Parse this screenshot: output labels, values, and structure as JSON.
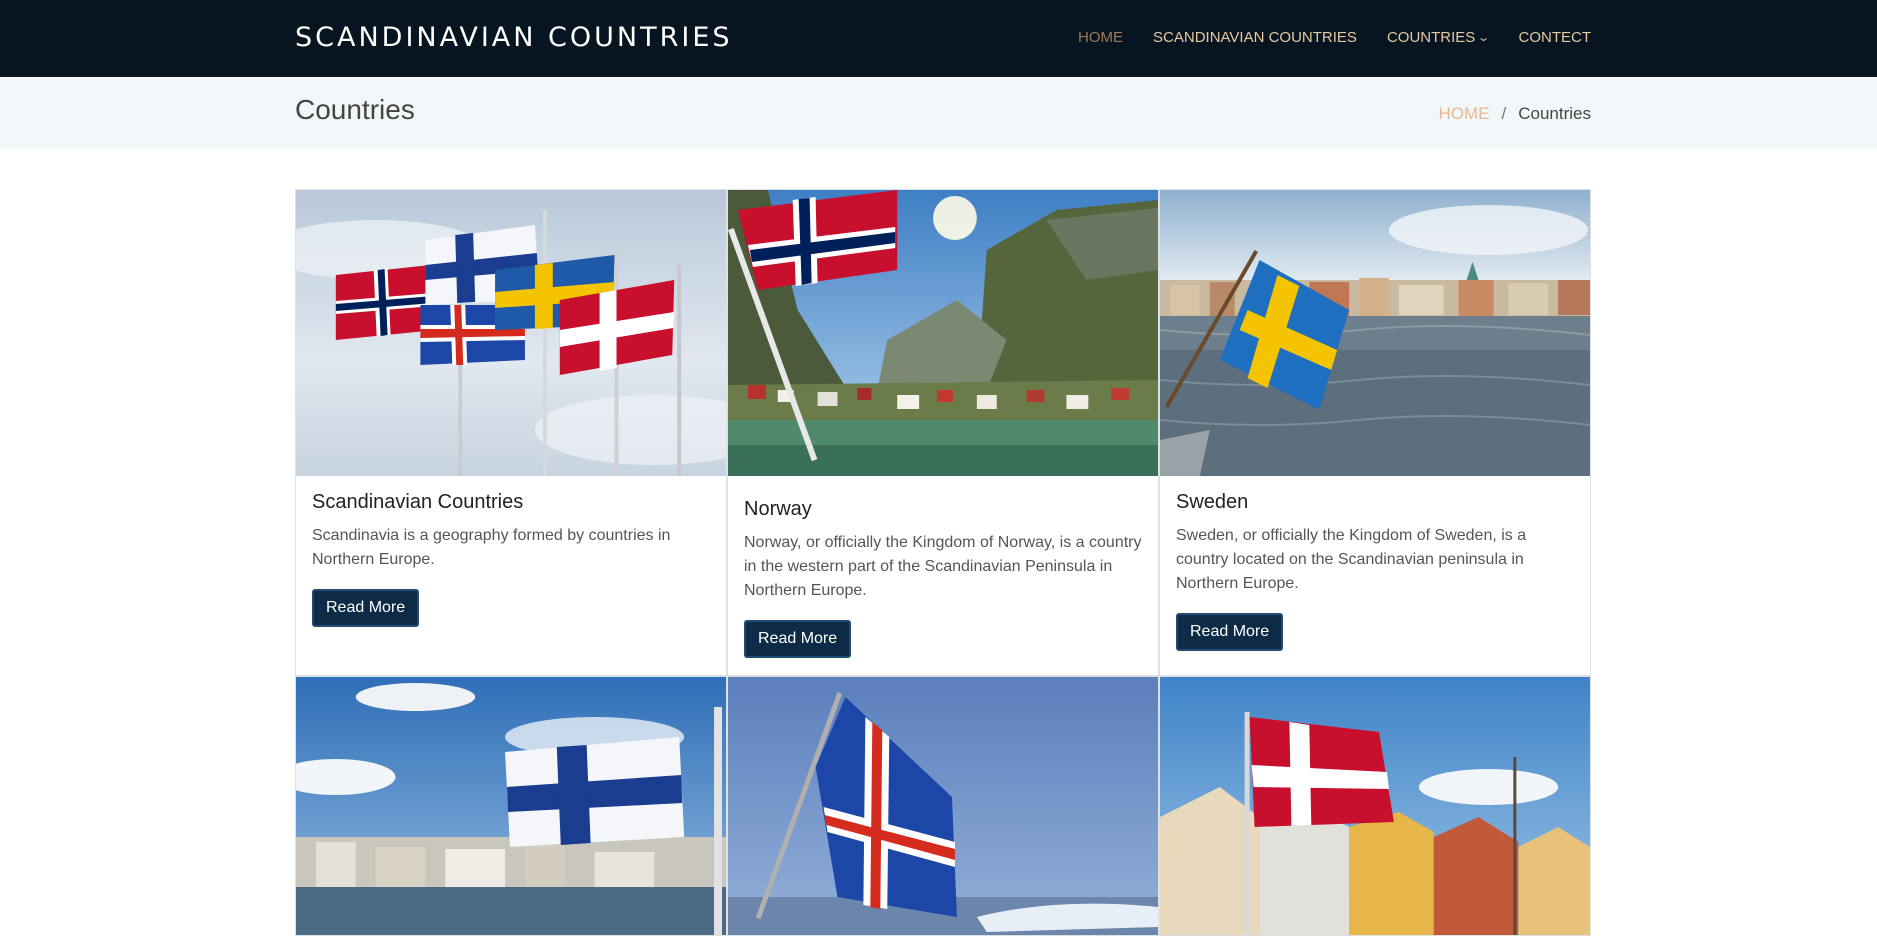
{
  "nav": {
    "brand": "SCANDINAVIAN COUNTRIES",
    "items": [
      {
        "label": "HOME",
        "active": true
      },
      {
        "label": "SCANDINAVIAN COUNTRIES"
      },
      {
        "label": "COUNTRIES",
        "has_dropdown": true
      },
      {
        "label": "CONTECT"
      }
    ]
  },
  "page": {
    "title": "Countries",
    "breadcrumb": {
      "home": "HOME",
      "separator": "/",
      "current": "Countries"
    }
  },
  "cards": [
    {
      "title": "Scandinavian Countries",
      "text": "Scandinavia is a geography formed by countries in Northern Europe.",
      "button": "Read More",
      "image": "flags-of-scandinavia-photo"
    },
    {
      "title": "Norway",
      "text": "Norway, or officially the Kingdom of Norway, is a country in the western part of the Scandinavian Peninsula in Northern Europe.",
      "button": "Read More",
      "image": "norway-flag-fjord-photo"
    },
    {
      "title": "Sweden",
      "text": "Sweden, or officially the Kingdom of Sweden, is a country located on the Scandinavian peninsula in Northern Europe.",
      "button": "Read More",
      "image": "sweden-flag-city-photo"
    },
    {
      "image": "finland-flag-harbor-photo"
    },
    {
      "image": "iceland-flag-sky-photo"
    },
    {
      "image": "denmark-flag-houses-photo"
    }
  ],
  "colors": {
    "navbar": "#061520",
    "nav_link": "#e8c9a0",
    "nav_active": "#9c7b55",
    "button": "#0d2a46",
    "titlebar": "#f2f7fa"
  }
}
